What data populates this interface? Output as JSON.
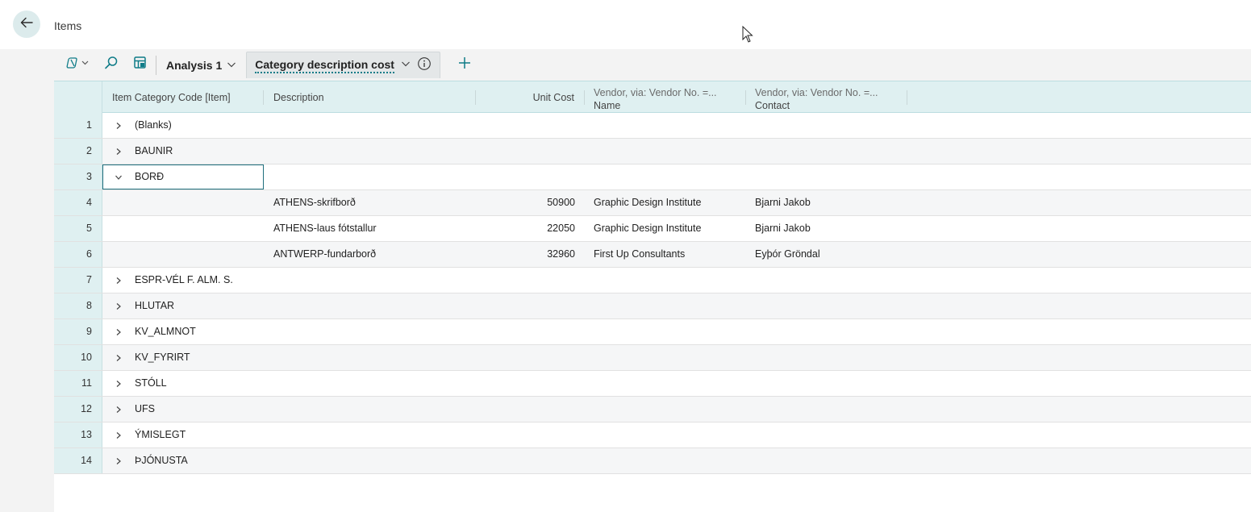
{
  "header": {
    "title": "Items"
  },
  "toolbar": {
    "analysis_tab": "Analysis 1",
    "active_tab": "Category description cost"
  },
  "columns": {
    "category": "Item Category Code [Item]",
    "description": "Description",
    "unit_cost": "Unit Cost",
    "vendor_name_l1": "Vendor, via: Vendor No. =...",
    "vendor_name_l2": "Name",
    "vendor_contact_l1": "Vendor, via: Vendor No. =...",
    "vendor_contact_l2": "Contact"
  },
  "rows": [
    {
      "num": "1",
      "category": "(Blanks)",
      "expander": "collapsed",
      "description": "",
      "unit_cost": "",
      "vendor_name": "",
      "vendor_contact": ""
    },
    {
      "num": "2",
      "category": "BAUNIR",
      "expander": "collapsed",
      "description": "",
      "unit_cost": "",
      "vendor_name": "",
      "vendor_contact": ""
    },
    {
      "num": "3",
      "category": "BORÐ",
      "expander": "expanded",
      "description": "",
      "unit_cost": "",
      "vendor_name": "",
      "vendor_contact": ""
    },
    {
      "num": "4",
      "category": "",
      "expander": "none",
      "description": "ATHENS-skrifborð",
      "unit_cost": "50900",
      "vendor_name": "Graphic Design Institute",
      "vendor_contact": "Bjarni Jakob"
    },
    {
      "num": "5",
      "category": "",
      "expander": "none",
      "description": "ATHENS-laus fótstallur",
      "unit_cost": "22050",
      "vendor_name": "Graphic Design Institute",
      "vendor_contact": "Bjarni Jakob"
    },
    {
      "num": "6",
      "category": "",
      "expander": "none",
      "description": "ANTWERP-fundarborð",
      "unit_cost": "32960",
      "vendor_name": "First Up Consultants",
      "vendor_contact": "Eyþór Gröndal"
    },
    {
      "num": "7",
      "category": "ESPR-VÉL F. ALM. S.",
      "expander": "collapsed",
      "description": "",
      "unit_cost": "",
      "vendor_name": "",
      "vendor_contact": ""
    },
    {
      "num": "8",
      "category": "HLUTAR",
      "expander": "collapsed",
      "description": "",
      "unit_cost": "",
      "vendor_name": "",
      "vendor_contact": ""
    },
    {
      "num": "9",
      "category": "KV_ALMNOT",
      "expander": "collapsed",
      "description": "",
      "unit_cost": "",
      "vendor_name": "",
      "vendor_contact": ""
    },
    {
      "num": "10",
      "category": "KV_FYRIRT",
      "expander": "collapsed",
      "description": "",
      "unit_cost": "",
      "vendor_name": "",
      "vendor_contact": ""
    },
    {
      "num": "11",
      "category": "STÓLL",
      "expander": "collapsed",
      "description": "",
      "unit_cost": "",
      "vendor_name": "",
      "vendor_contact": ""
    },
    {
      "num": "12",
      "category": "UFS",
      "expander": "collapsed",
      "description": "",
      "unit_cost": "",
      "vendor_name": "",
      "vendor_contact": ""
    },
    {
      "num": "13",
      "category": "ÝMISLEGT",
      "expander": "collapsed",
      "description": "",
      "unit_cost": "",
      "vendor_name": "",
      "vendor_contact": ""
    },
    {
      "num": "14",
      "category": "ÞJÓNUSTA",
      "expander": "collapsed",
      "description": "",
      "unit_cost": "",
      "vendor_name": "",
      "vendor_contact": ""
    }
  ],
  "colors": {
    "accent": "#0f7c88",
    "header_bg": "#dff0f1",
    "back_button_bg": "#dcebec"
  }
}
